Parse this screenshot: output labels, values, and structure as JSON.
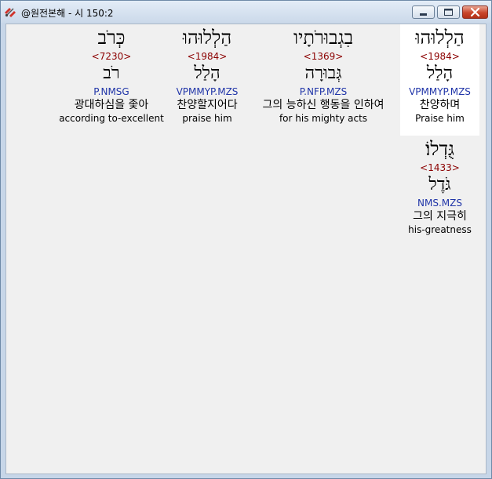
{
  "window": {
    "title": "@원전본해 - 시 150:2"
  },
  "words": [
    {
      "hebrew": "הַלְלוּהוּ",
      "strong": "<1984>",
      "lemma": "הָלַל",
      "parse": "VPMMYP.MZS",
      "korean": "찬양하며",
      "english": "Praise him"
    },
    {
      "hebrew": "בִגְבוּרֹתָיו",
      "strong": "<1369>",
      "lemma": "גְּבוּרָה",
      "parse": "P.NFP.MZS",
      "korean": "그의 능하신 행동을 인하여",
      "english": "for his mighty acts"
    },
    {
      "hebrew": "הַלְלוּהוּ",
      "strong": "<1984>",
      "lemma": "הָלַל",
      "parse": "VPMMYP.MZS",
      "korean": "찬양할지어다",
      "english": "praise him"
    },
    {
      "hebrew": "כְּרֹב",
      "strong": "<7230>",
      "lemma": "רֹב",
      "parse": "P.NMSG",
      "korean": "광대하심을 좇아",
      "english": "according to-excellent"
    },
    {
      "hebrew": "גֻּדְלוֹ׃",
      "strong": "<1433>",
      "lemma": "גֹּדֶל",
      "parse": "NMS.MZS",
      "korean": "그의 지극히",
      "english": "his-greatness"
    }
  ]
}
